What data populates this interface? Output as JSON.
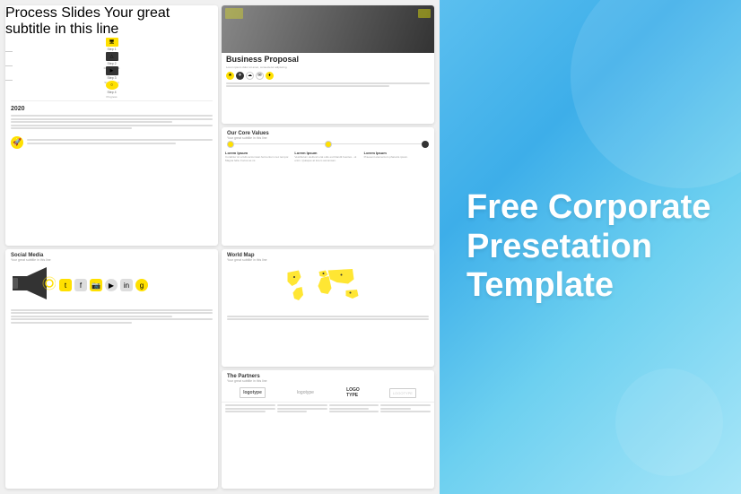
{
  "slides": [
    {
      "id": "process",
      "title": "Process Slides",
      "subtitle": "Your great subtitle in this line",
      "year": "2020",
      "steps": [
        "Step 1",
        "Step 2",
        "Step 3",
        "Step 4"
      ],
      "step_labels": [
        "Market",
        "Development",
        "Start Project",
        "Progress"
      ]
    },
    {
      "id": "business",
      "title": "Business Proposal",
      "subtitle": "Lorem ipsum dolor sit amet"
    },
    {
      "id": "values",
      "title": "Our Core Values",
      "subtitle": "Your great subtitle in this line",
      "columns": [
        "Lorem Ipsum",
        "Lorem Ipsum",
        "Lorem Ipsum"
      ]
    },
    {
      "id": "social",
      "title": "Social Media",
      "subtitle": "Your great subtitle in this line"
    },
    {
      "id": "map",
      "title": "World Map",
      "subtitle": "Your great subtitle in this line"
    },
    {
      "id": "partners",
      "title": "The Partners",
      "subtitle": "Your great subtitle in this line",
      "logos": [
        "logotype",
        "logotype",
        "LOGO TYPE",
        "LOGOTYPE"
      ]
    }
  ],
  "promo": {
    "line1": "Free Corporate",
    "line2": "Presetation",
    "line3": "Template"
  }
}
